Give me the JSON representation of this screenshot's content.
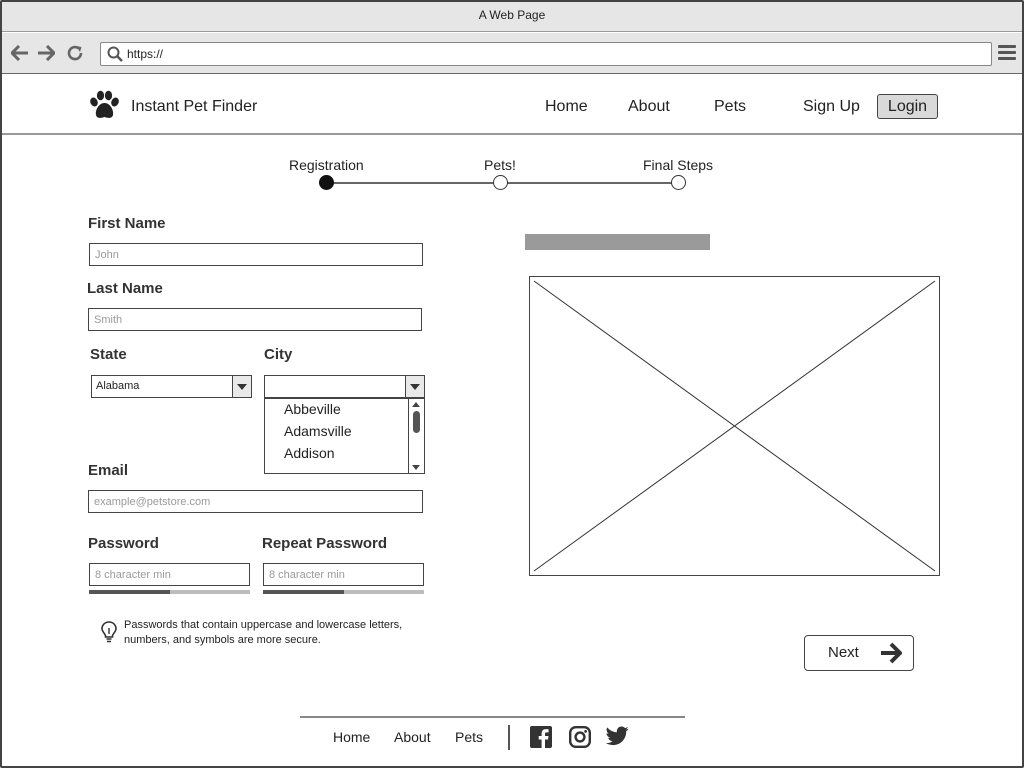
{
  "browser": {
    "window_title": "A Web Page",
    "url": "https://"
  },
  "header": {
    "brand": "Instant Pet Finder",
    "menu": [
      "Home",
      "About",
      "Pets",
      "Sign Up"
    ],
    "login_label": "Login"
  },
  "stepper": {
    "steps": [
      "Registration",
      "Pets!",
      "Final Steps"
    ],
    "active_step": 0
  },
  "form": {
    "first_name": {
      "label": "First Name",
      "placeholder": "John"
    },
    "last_name": {
      "label": "Last Name",
      "placeholder": "Smith"
    },
    "state": {
      "label": "State",
      "selected": "Alabama"
    },
    "city": {
      "label": "City",
      "selected": "",
      "options": [
        "Abbeville",
        "Adamsville",
        "Addison"
      ]
    },
    "email": {
      "label": "Email",
      "placeholder": "example@petstore.com"
    },
    "password": {
      "label": "Password",
      "placeholder": "8 character min",
      "strength": 0.5
    },
    "repeat_password": {
      "label": "Repeat Password",
      "placeholder": "8 character min",
      "strength": 0.5
    },
    "tip": "Passwords that contain uppercase and lowercase letters, numbers, and symbols are more secure."
  },
  "actions": {
    "next_label": "Next"
  },
  "footer": {
    "links": [
      "Home",
      "About",
      "Pets"
    ],
    "social": [
      "facebook-icon",
      "instagram-icon",
      "twitter-icon"
    ]
  },
  "colors": {
    "chrome_bg": "#e6e6e6",
    "login_bg": "#d9d9d9",
    "heading_placeholder": "#9a9a9a",
    "strength_fill": "#555555"
  }
}
